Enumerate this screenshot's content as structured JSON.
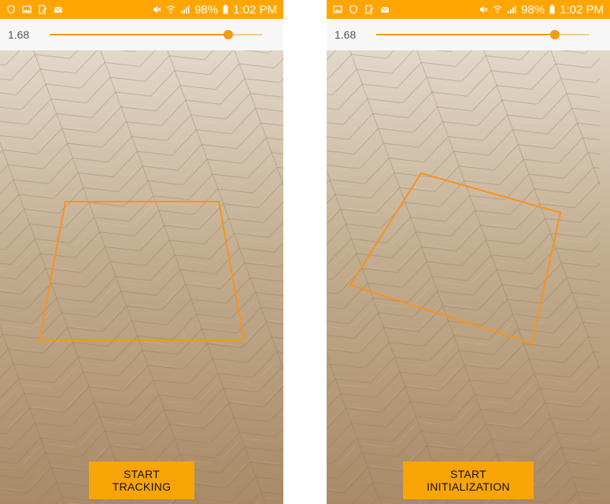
{
  "colors": {
    "status_bar": "#ffa500",
    "accent": "#f39c12",
    "overlay_line": "#f7931e",
    "button_bg": "#f9a407"
  },
  "left_screen": {
    "status_bar": {
      "battery": "98%",
      "time": "1:02 PM",
      "left_icons": [
        "shield-icon",
        "image-icon",
        "edit-icon",
        "mail-icon"
      ],
      "right_icons": [
        "mute-icon",
        "wifi-icon",
        "signal-icon",
        "battery-icon"
      ]
    },
    "slider": {
      "value_label": "1.68",
      "fraction": 0.84
    },
    "button_label": "START TRACKING"
  },
  "right_screen": {
    "status_bar": {
      "battery": "98%",
      "time": "1:02 PM",
      "left_icons": [
        "image-icon",
        "shield-icon",
        "edit-icon",
        "mail-icon"
      ],
      "right_icons": [
        "mute-icon",
        "wifi-icon",
        "signal-icon",
        "battery-icon"
      ]
    },
    "slider": {
      "value_label": "1.68",
      "fraction": 0.84
    },
    "button_label": "START INITIALIZATION"
  }
}
